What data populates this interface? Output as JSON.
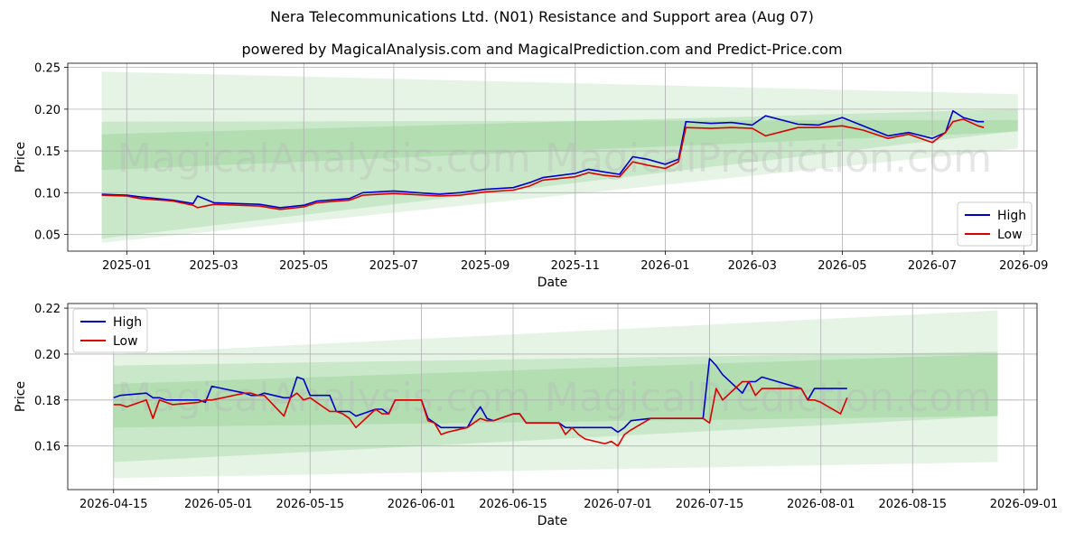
{
  "header": {
    "title": "Nera Telecommunications Ltd. (N01) Resistance and Support area (Aug 07)",
    "subtitle": "powered by MagicalAnalysis.com and MagicalPrediction.com and Predict-Price.com"
  },
  "watermark": {
    "left": "MagicalAnalysis.com",
    "right": "MagicalPrediction.com"
  },
  "colors": {
    "high": "#0000cc",
    "low": "#dd0000",
    "band": "#5cb85c"
  },
  "chart_data": [
    {
      "type": "line",
      "xlabel": "Date",
      "ylabel": "Price",
      "xlim": [
        "2024-11-22",
        "2026-09-10"
      ],
      "ylim": [
        0.03,
        0.255
      ],
      "xticks": [
        "2025-01-01",
        "2025-03-01",
        "2025-05-01",
        "2025-07-01",
        "2025-09-01",
        "2025-11-01",
        "2026-01-01",
        "2026-03-01",
        "2026-05-01",
        "2026-07-01",
        "2026-09-01"
      ],
      "xtick_labels": [
        "2025-01",
        "2025-03",
        "2025-05",
        "2025-07",
        "2025-09",
        "2025-11",
        "2026-01",
        "2026-03",
        "2026-05",
        "2026-07",
        "2026-09"
      ],
      "yticks": [
        0.05,
        0.1,
        0.15,
        0.2,
        0.25
      ],
      "ytick_labels": [
        "0.05",
        "0.10",
        "0.15",
        "0.20",
        "0.25"
      ],
      "legend": {
        "position": "lower-right",
        "entries": [
          "High",
          "Low"
        ]
      },
      "grid": true,
      "bands": [
        {
          "x": [
            "2024-12-15",
            "2026-08-28"
          ],
          "upper": [
            0.245,
            0.218
          ],
          "lower": [
            0.04,
            0.153
          ]
        },
        {
          "x": [
            "2024-12-15",
            "2026-08-28"
          ],
          "upper": [
            0.17,
            0.2
          ],
          "lower": [
            0.127,
            0.173
          ]
        },
        {
          "x": [
            "2024-12-15",
            "2026-08-28"
          ],
          "upper": [
            0.185,
            0.187
          ],
          "lower": [
            0.045,
            0.174
          ]
        }
      ],
      "series": [
        {
          "name": "High",
          "x": [
            "2024-12-15",
            "2025-01-01",
            "2025-01-10",
            "2025-02-01",
            "2025-02-15",
            "2025-02-18",
            "2025-03-01",
            "2025-04-01",
            "2025-04-15",
            "2025-05-01",
            "2025-05-10",
            "2025-06-01",
            "2025-06-10",
            "2025-07-01",
            "2025-08-01",
            "2025-08-15",
            "2025-09-01",
            "2025-09-20",
            "2025-10-01",
            "2025-10-10",
            "2025-11-01",
            "2025-11-10",
            "2025-11-20",
            "2025-12-01",
            "2025-12-10",
            "2025-12-20",
            "2026-01-01",
            "2026-01-10",
            "2026-01-15",
            "2026-02-01",
            "2026-02-15",
            "2026-03-01",
            "2026-03-10",
            "2026-04-01",
            "2026-04-15",
            "2026-05-01",
            "2026-05-15",
            "2026-06-01",
            "2026-06-15",
            "2026-07-01",
            "2026-07-10",
            "2026-07-15",
            "2026-07-22",
            "2026-08-01",
            "2026-08-05"
          ],
          "values": [
            0.098,
            0.097,
            0.095,
            0.091,
            0.087,
            0.096,
            0.088,
            0.086,
            0.082,
            0.085,
            0.09,
            0.093,
            0.1,
            0.102,
            0.098,
            0.1,
            0.104,
            0.106,
            0.112,
            0.118,
            0.123,
            0.128,
            0.125,
            0.122,
            0.143,
            0.14,
            0.134,
            0.14,
            0.185,
            0.183,
            0.184,
            0.181,
            0.192,
            0.182,
            0.181,
            0.19,
            0.18,
            0.168,
            0.172,
            0.165,
            0.172,
            0.198,
            0.19,
            0.185,
            0.185
          ]
        },
        {
          "name": "Low",
          "x": [
            "2024-12-15",
            "2025-01-01",
            "2025-01-10",
            "2025-02-01",
            "2025-02-15",
            "2025-02-18",
            "2025-03-01",
            "2025-04-01",
            "2025-04-15",
            "2025-05-01",
            "2025-05-10",
            "2025-06-01",
            "2025-06-10",
            "2025-07-01",
            "2025-08-01",
            "2025-08-15",
            "2025-09-01",
            "2025-09-20",
            "2025-10-01",
            "2025-10-10",
            "2025-11-01",
            "2025-11-10",
            "2025-11-20",
            "2025-12-01",
            "2025-12-10",
            "2025-12-20",
            "2026-01-01",
            "2026-01-10",
            "2026-01-15",
            "2026-02-01",
            "2026-02-15",
            "2026-03-01",
            "2026-03-10",
            "2026-04-01",
            "2026-04-15",
            "2026-05-01",
            "2026-05-15",
            "2026-06-01",
            "2026-06-15",
            "2026-07-01",
            "2026-07-10",
            "2026-07-15",
            "2026-07-22",
            "2026-08-01",
            "2026-08-05"
          ],
          "values": [
            0.097,
            0.096,
            0.093,
            0.09,
            0.085,
            0.082,
            0.086,
            0.084,
            0.08,
            0.083,
            0.088,
            0.091,
            0.097,
            0.099,
            0.096,
            0.097,
            0.101,
            0.103,
            0.108,
            0.115,
            0.119,
            0.124,
            0.121,
            0.119,
            0.137,
            0.133,
            0.129,
            0.137,
            0.178,
            0.177,
            0.178,
            0.177,
            0.168,
            0.178,
            0.178,
            0.18,
            0.175,
            0.165,
            0.17,
            0.16,
            0.172,
            0.185,
            0.188,
            0.18,
            0.178
          ]
        }
      ]
    },
    {
      "type": "line",
      "xlabel": "Date",
      "ylabel": "Price",
      "xlim": [
        "2026-04-08",
        "2026-09-03"
      ],
      "ylim": [
        0.141,
        0.222
      ],
      "xticks": [
        "2026-04-15",
        "2026-05-01",
        "2026-05-15",
        "2026-06-01",
        "2026-06-15",
        "2026-07-01",
        "2026-07-15",
        "2026-08-01",
        "2026-08-15",
        "2026-09-01"
      ],
      "xtick_labels": [
        "2026-04-15",
        "2026-05-01",
        "2026-05-15",
        "2026-06-01",
        "2026-06-15",
        "2026-07-01",
        "2026-07-15",
        "2026-08-01",
        "2026-08-15",
        "2026-09-01"
      ],
      "yticks": [
        0.16,
        0.18,
        0.2,
        0.22
      ],
      "ytick_labels": [
        "0.16",
        "0.18",
        "0.20",
        "0.22"
      ],
      "legend": {
        "position": "upper-left",
        "entries": [
          "High",
          "Low"
        ]
      },
      "grid": true,
      "bands": [
        {
          "x": [
            "2026-04-15",
            "2026-08-28"
          ],
          "upper": [
            0.2,
            0.219
          ],
          "lower": [
            0.146,
            0.153
          ]
        },
        {
          "x": [
            "2026-04-15",
            "2026-08-28"
          ],
          "upper": [
            0.195,
            0.201
          ],
          "lower": [
            0.168,
            0.173
          ]
        },
        {
          "x": [
            "2026-04-15",
            "2026-08-28"
          ],
          "upper": [
            0.187,
            0.2
          ],
          "lower": [
            0.153,
            0.173
          ]
        }
      ],
      "series": [
        {
          "name": "High",
          "x": [
            "2026-04-15",
            "2026-04-16",
            "2026-04-20",
            "2026-04-21",
            "2026-04-22",
            "2026-04-23",
            "2026-04-24",
            "2026-04-28",
            "2026-04-29",
            "2026-04-30",
            "2026-05-05",
            "2026-05-06",
            "2026-05-07",
            "2026-05-08",
            "2026-05-11",
            "2026-05-12",
            "2026-05-13",
            "2026-05-14",
            "2026-05-15",
            "2026-05-18",
            "2026-05-19",
            "2026-05-20",
            "2026-05-21",
            "2026-05-22",
            "2026-05-25",
            "2026-05-26",
            "2026-05-27",
            "2026-05-28",
            "2026-06-01",
            "2026-06-02",
            "2026-06-03",
            "2026-06-04",
            "2026-06-05",
            "2026-06-08",
            "2026-06-09",
            "2026-06-10",
            "2026-06-11",
            "2026-06-12",
            "2026-06-15",
            "2026-06-16",
            "2026-06-17",
            "2026-06-18",
            "2026-06-19",
            "2026-06-22",
            "2026-06-23",
            "2026-06-24",
            "2026-06-25",
            "2026-06-26",
            "2026-06-29",
            "2026-06-30",
            "2026-07-01",
            "2026-07-02",
            "2026-07-03",
            "2026-07-06",
            "2026-07-14",
            "2026-07-15",
            "2026-07-16",
            "2026-07-17",
            "2026-07-20",
            "2026-07-21",
            "2026-07-22",
            "2026-07-23",
            "2026-07-29",
            "2026-07-30",
            "2026-07-31",
            "2026-08-05"
          ],
          "values": [
            0.181,
            0.182,
            0.183,
            0.181,
            0.181,
            0.18,
            0.18,
            0.18,
            0.179,
            0.186,
            0.183,
            0.182,
            0.182,
            0.183,
            0.181,
            0.181,
            0.19,
            0.189,
            0.182,
            0.182,
            0.175,
            0.175,
            0.175,
            0.173,
            0.176,
            0.176,
            0.174,
            0.18,
            0.18,
            0.172,
            0.17,
            0.168,
            0.168,
            0.168,
            0.173,
            0.177,
            0.172,
            0.171,
            0.174,
            0.174,
            0.17,
            0.17,
            0.17,
            0.17,
            0.168,
            0.168,
            0.168,
            0.168,
            0.168,
            0.168,
            0.166,
            0.168,
            0.171,
            0.172,
            0.172,
            0.198,
            0.195,
            0.191,
            0.183,
            0.188,
            0.188,
            0.19,
            0.185,
            0.18,
            0.185,
            0.185
          ]
        },
        {
          "name": "Low",
          "x": [
            "2026-04-15",
            "2026-04-16",
            "2026-04-17",
            "2026-04-20",
            "2026-04-21",
            "2026-04-22",
            "2026-04-23",
            "2026-04-24",
            "2026-04-28",
            "2026-04-29",
            "2026-04-30",
            "2026-05-05",
            "2026-05-06",
            "2026-05-07",
            "2026-05-08",
            "2026-05-11",
            "2026-05-12",
            "2026-05-13",
            "2026-05-14",
            "2026-05-15",
            "2026-05-18",
            "2026-05-19",
            "2026-05-20",
            "2026-05-21",
            "2026-05-22",
            "2026-05-25",
            "2026-05-26",
            "2026-05-27",
            "2026-05-28",
            "2026-06-01",
            "2026-06-02",
            "2026-06-03",
            "2026-06-04",
            "2026-06-05",
            "2026-06-08",
            "2026-06-09",
            "2026-06-10",
            "2026-06-11",
            "2026-06-12",
            "2026-06-15",
            "2026-06-16",
            "2026-06-17",
            "2026-06-18",
            "2026-06-19",
            "2026-06-22",
            "2026-06-23",
            "2026-06-24",
            "2026-06-25",
            "2026-06-26",
            "2026-06-29",
            "2026-06-30",
            "2026-07-01",
            "2026-07-02",
            "2026-07-03",
            "2026-07-06",
            "2026-07-14",
            "2026-07-15",
            "2026-07-16",
            "2026-07-17",
            "2026-07-20",
            "2026-07-21",
            "2026-07-22",
            "2026-07-23",
            "2026-07-29",
            "2026-07-30",
            "2026-07-31",
            "2026-08-01",
            "2026-08-04",
            "2026-08-05"
          ],
          "values": [
            0.178,
            0.178,
            0.177,
            0.18,
            0.172,
            0.18,
            0.179,
            0.178,
            0.179,
            0.18,
            0.18,
            0.183,
            0.183,
            0.182,
            0.182,
            0.173,
            0.181,
            0.183,
            0.18,
            0.181,
            0.175,
            0.175,
            0.174,
            0.172,
            0.168,
            0.176,
            0.174,
            0.174,
            0.18,
            0.18,
            0.171,
            0.17,
            0.165,
            0.166,
            0.168,
            0.17,
            0.172,
            0.171,
            0.171,
            0.174,
            0.174,
            0.17,
            0.17,
            0.17,
            0.17,
            0.165,
            0.168,
            0.165,
            0.163,
            0.161,
            0.162,
            0.16,
            0.165,
            0.167,
            0.172,
            0.172,
            0.17,
            0.185,
            0.18,
            0.188,
            0.188,
            0.182,
            0.185,
            0.185,
            0.18,
            0.18,
            0.179,
            0.174,
            0.181
          ]
        }
      ]
    }
  ]
}
